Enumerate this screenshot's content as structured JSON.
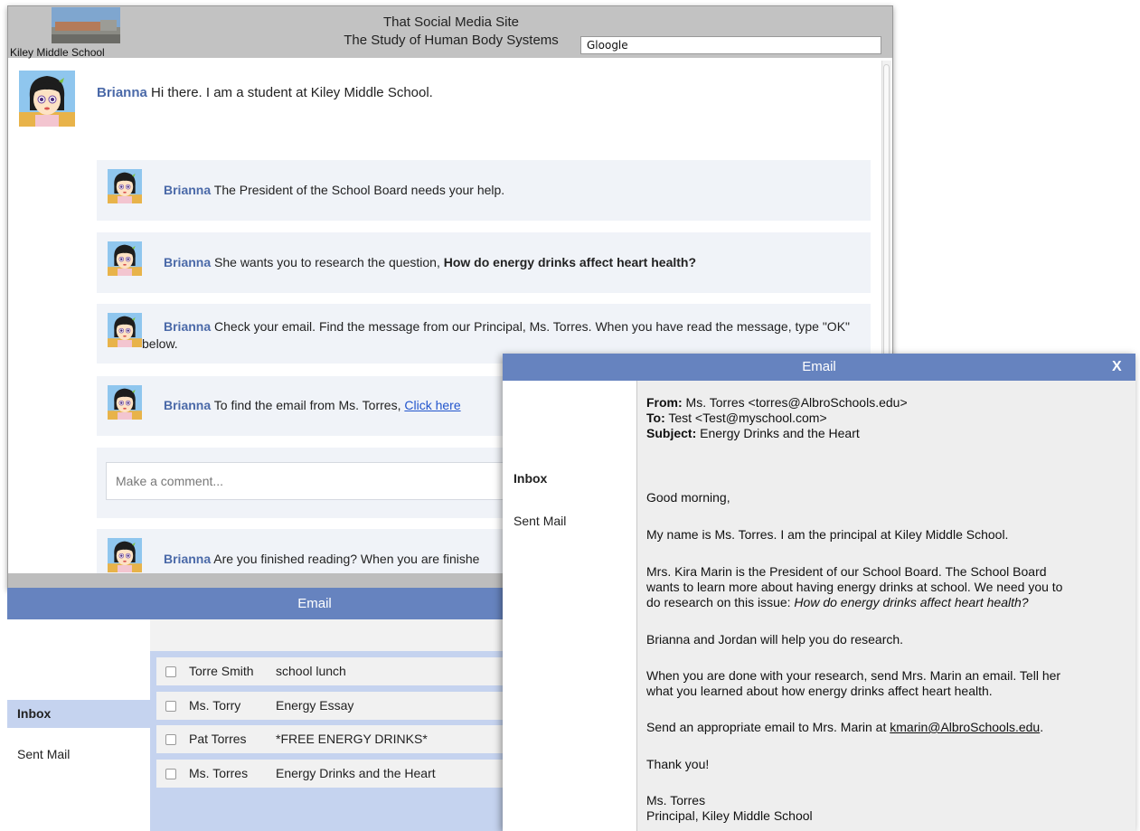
{
  "social": {
    "school_name": "Kiley Middle School",
    "site_title": "That Social Media Site",
    "site_subtitle": "The Study of Human Body Systems",
    "search_value": "Gloogle",
    "posts": [
      {
        "author": "Brianna",
        "text": " Hi there. I am a student at Kiley Middle School."
      },
      {
        "author": "Brianna",
        "text": " The President of the School Board needs your help."
      },
      {
        "author": "Brianna",
        "text": " She wants you to research the question, ",
        "bold": "How do energy drinks affect heart health?"
      },
      {
        "author": "Brianna",
        "text": " Check your email. Find the message from our Principal, Ms. Torres. When you have read the message, type \"OK\" below."
      },
      {
        "author": "Brianna",
        "text": " To find the email from Ms. Torres,  ",
        "link": "Click here"
      },
      {
        "author": "Brianna",
        "text": " Are you finished reading? When you are finishe"
      }
    ],
    "comment_placeholder": "Make a comment..."
  },
  "email_list": {
    "title": "Email",
    "nav_inbox": "Inbox",
    "nav_sent": "Sent Mail",
    "rows": [
      {
        "from": "Torre Smith",
        "subject": "school lunch"
      },
      {
        "from": "Ms. Torry",
        "subject": "Energy Essay"
      },
      {
        "from": "Pat Torres",
        "subject": "*FREE ENERGY DRINKS*"
      },
      {
        "from": "Ms. Torres",
        "subject": "Energy Drinks and the Heart"
      }
    ]
  },
  "email_msg": {
    "title": "Email",
    "close": "X",
    "nav_inbox": "Inbox",
    "nav_sent": "Sent Mail",
    "from_label": "From:",
    "from_value": " Ms. Torres  <torres@AlbroSchools.edu>",
    "to_label": "To:",
    "to_value": " Test  <Test@myschool.com>",
    "subject_label": "Subject:",
    "subject_value": " Energy Drinks and the Heart",
    "greeting": "Good morning,",
    "p1": "My name is Ms. Torres. I am the principal at Kiley Middle School.",
    "p2_l1": "Mrs. Kira Marin is the President of our School Board. The School Board",
    "p2_l2": "wants to learn more about having energy drinks at school. We need you to",
    "p2_l3a": "do research on this issue: ",
    "p2_l3b": "How do energy drinks affect heart health?",
    "p3": "Brianna and Jordan will help you do research.",
    "p4_l1": "When you are done with your research, send Mrs. Marin an email. Tell her",
    "p4_l2": "what you learned about how energy drinks affect heart health.",
    "p5a": "Send an appropriate email to Mrs. Marin at ",
    "p5_link": "kmarin@AlbroSchools.edu",
    "p5b": ".",
    "thanks": "Thank you!",
    "sig1": "Ms. Torres",
    "sig2": "Principal, Kiley Middle School"
  }
}
